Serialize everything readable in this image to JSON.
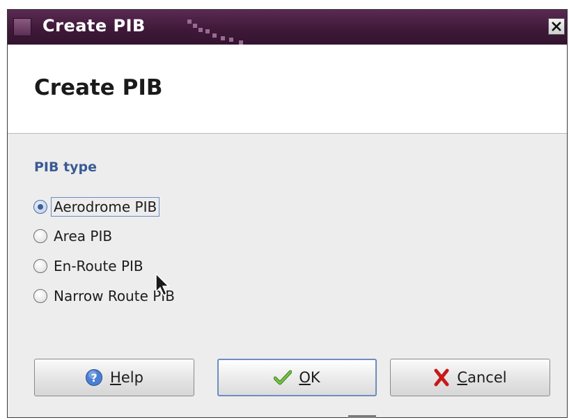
{
  "window": {
    "title": "Create PIB",
    "close_glyph": "✕"
  },
  "header": {
    "heading": "Create PIB"
  },
  "group": {
    "title": "PIB type",
    "options": [
      {
        "label": "Aerodrome PIB",
        "checked": true
      },
      {
        "label": "Area PIB",
        "checked": false
      },
      {
        "label": "En-Route PIB",
        "checked": false
      },
      {
        "label": "Narrow Route PIB",
        "checked": false
      }
    ]
  },
  "buttons": {
    "help": {
      "mnemonic": "H",
      "rest": "elp",
      "icon": "help-icon"
    },
    "ok": {
      "mnemonic": "O",
      "rest": "K",
      "icon": "checkmark-icon"
    },
    "cancel": {
      "mnemonic": "C",
      "rest": "ancel",
      "icon": "x-icon"
    }
  },
  "colors": {
    "titlebar": "#3e1838",
    "group_title": "#3a5a94",
    "focus": "#6a8ac4",
    "ok_icon": "#5aa02c",
    "cancel_icon": "#d42020",
    "help_icon": "#3e6fc4"
  }
}
